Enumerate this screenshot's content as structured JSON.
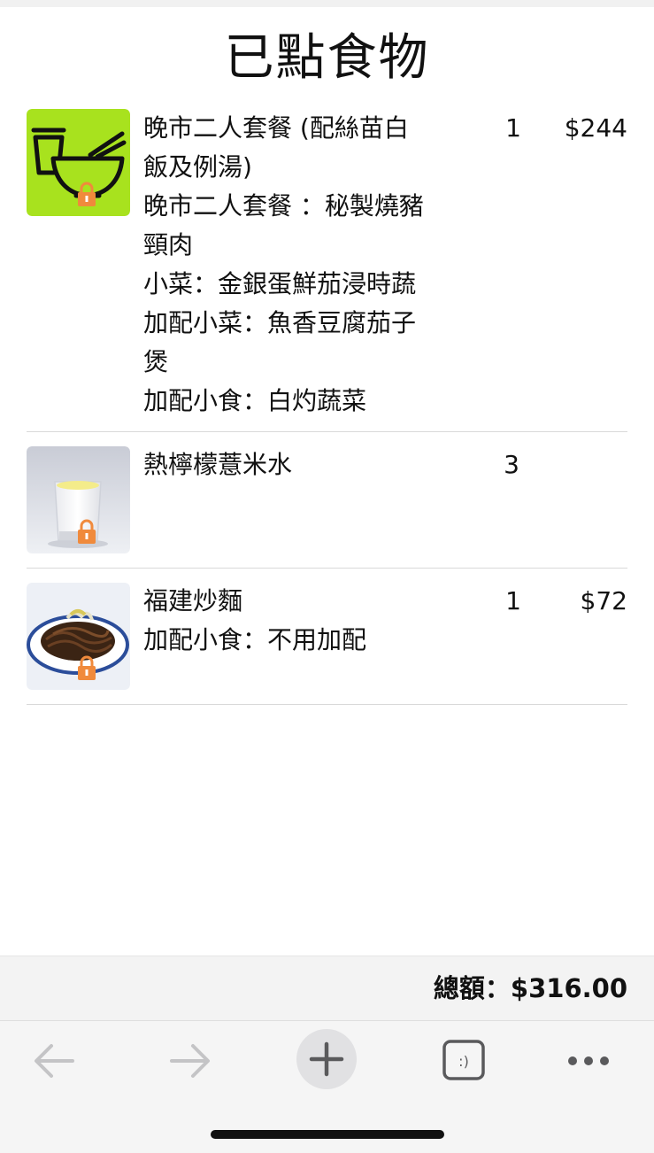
{
  "page": {
    "title": "已點食物"
  },
  "order": {
    "items": [
      {
        "lines": [
          "晚市二人套餐 (配絲苗白",
          "飯及例湯)",
          "晚市二人套餐 ：秘製燒豬",
          "頸肉",
          "小菜：金銀蛋鮮茄浸時蔬",
          "加配小菜：魚香豆腐茄子",
          "煲",
          "加配小食：白灼蔬菜"
        ],
        "qty": "1",
        "price": "$244",
        "icon": "rice-bowl-icon"
      },
      {
        "lines": [
          "熱檸檬薏米水"
        ],
        "qty": "3",
        "price": "",
        "icon": "drink-photo"
      },
      {
        "lines": [
          "福建炒麵",
          "加配小食：不用加配"
        ],
        "qty": "1",
        "price": "$72",
        "icon": "noodle-photo"
      }
    ],
    "total": "總額：$316.00"
  },
  "toolbar": {
    "icons": [
      "back-arrow-icon",
      "forward-arrow-icon",
      "plus-icon",
      "tabs-icon",
      "more-icon"
    ],
    "tabs_glyph": ":)"
  },
  "colors": {
    "icon_bg_green": "#a8e21e",
    "lock_orange": "#f08a3c",
    "total_bar_bg": "#f3f3f3"
  }
}
